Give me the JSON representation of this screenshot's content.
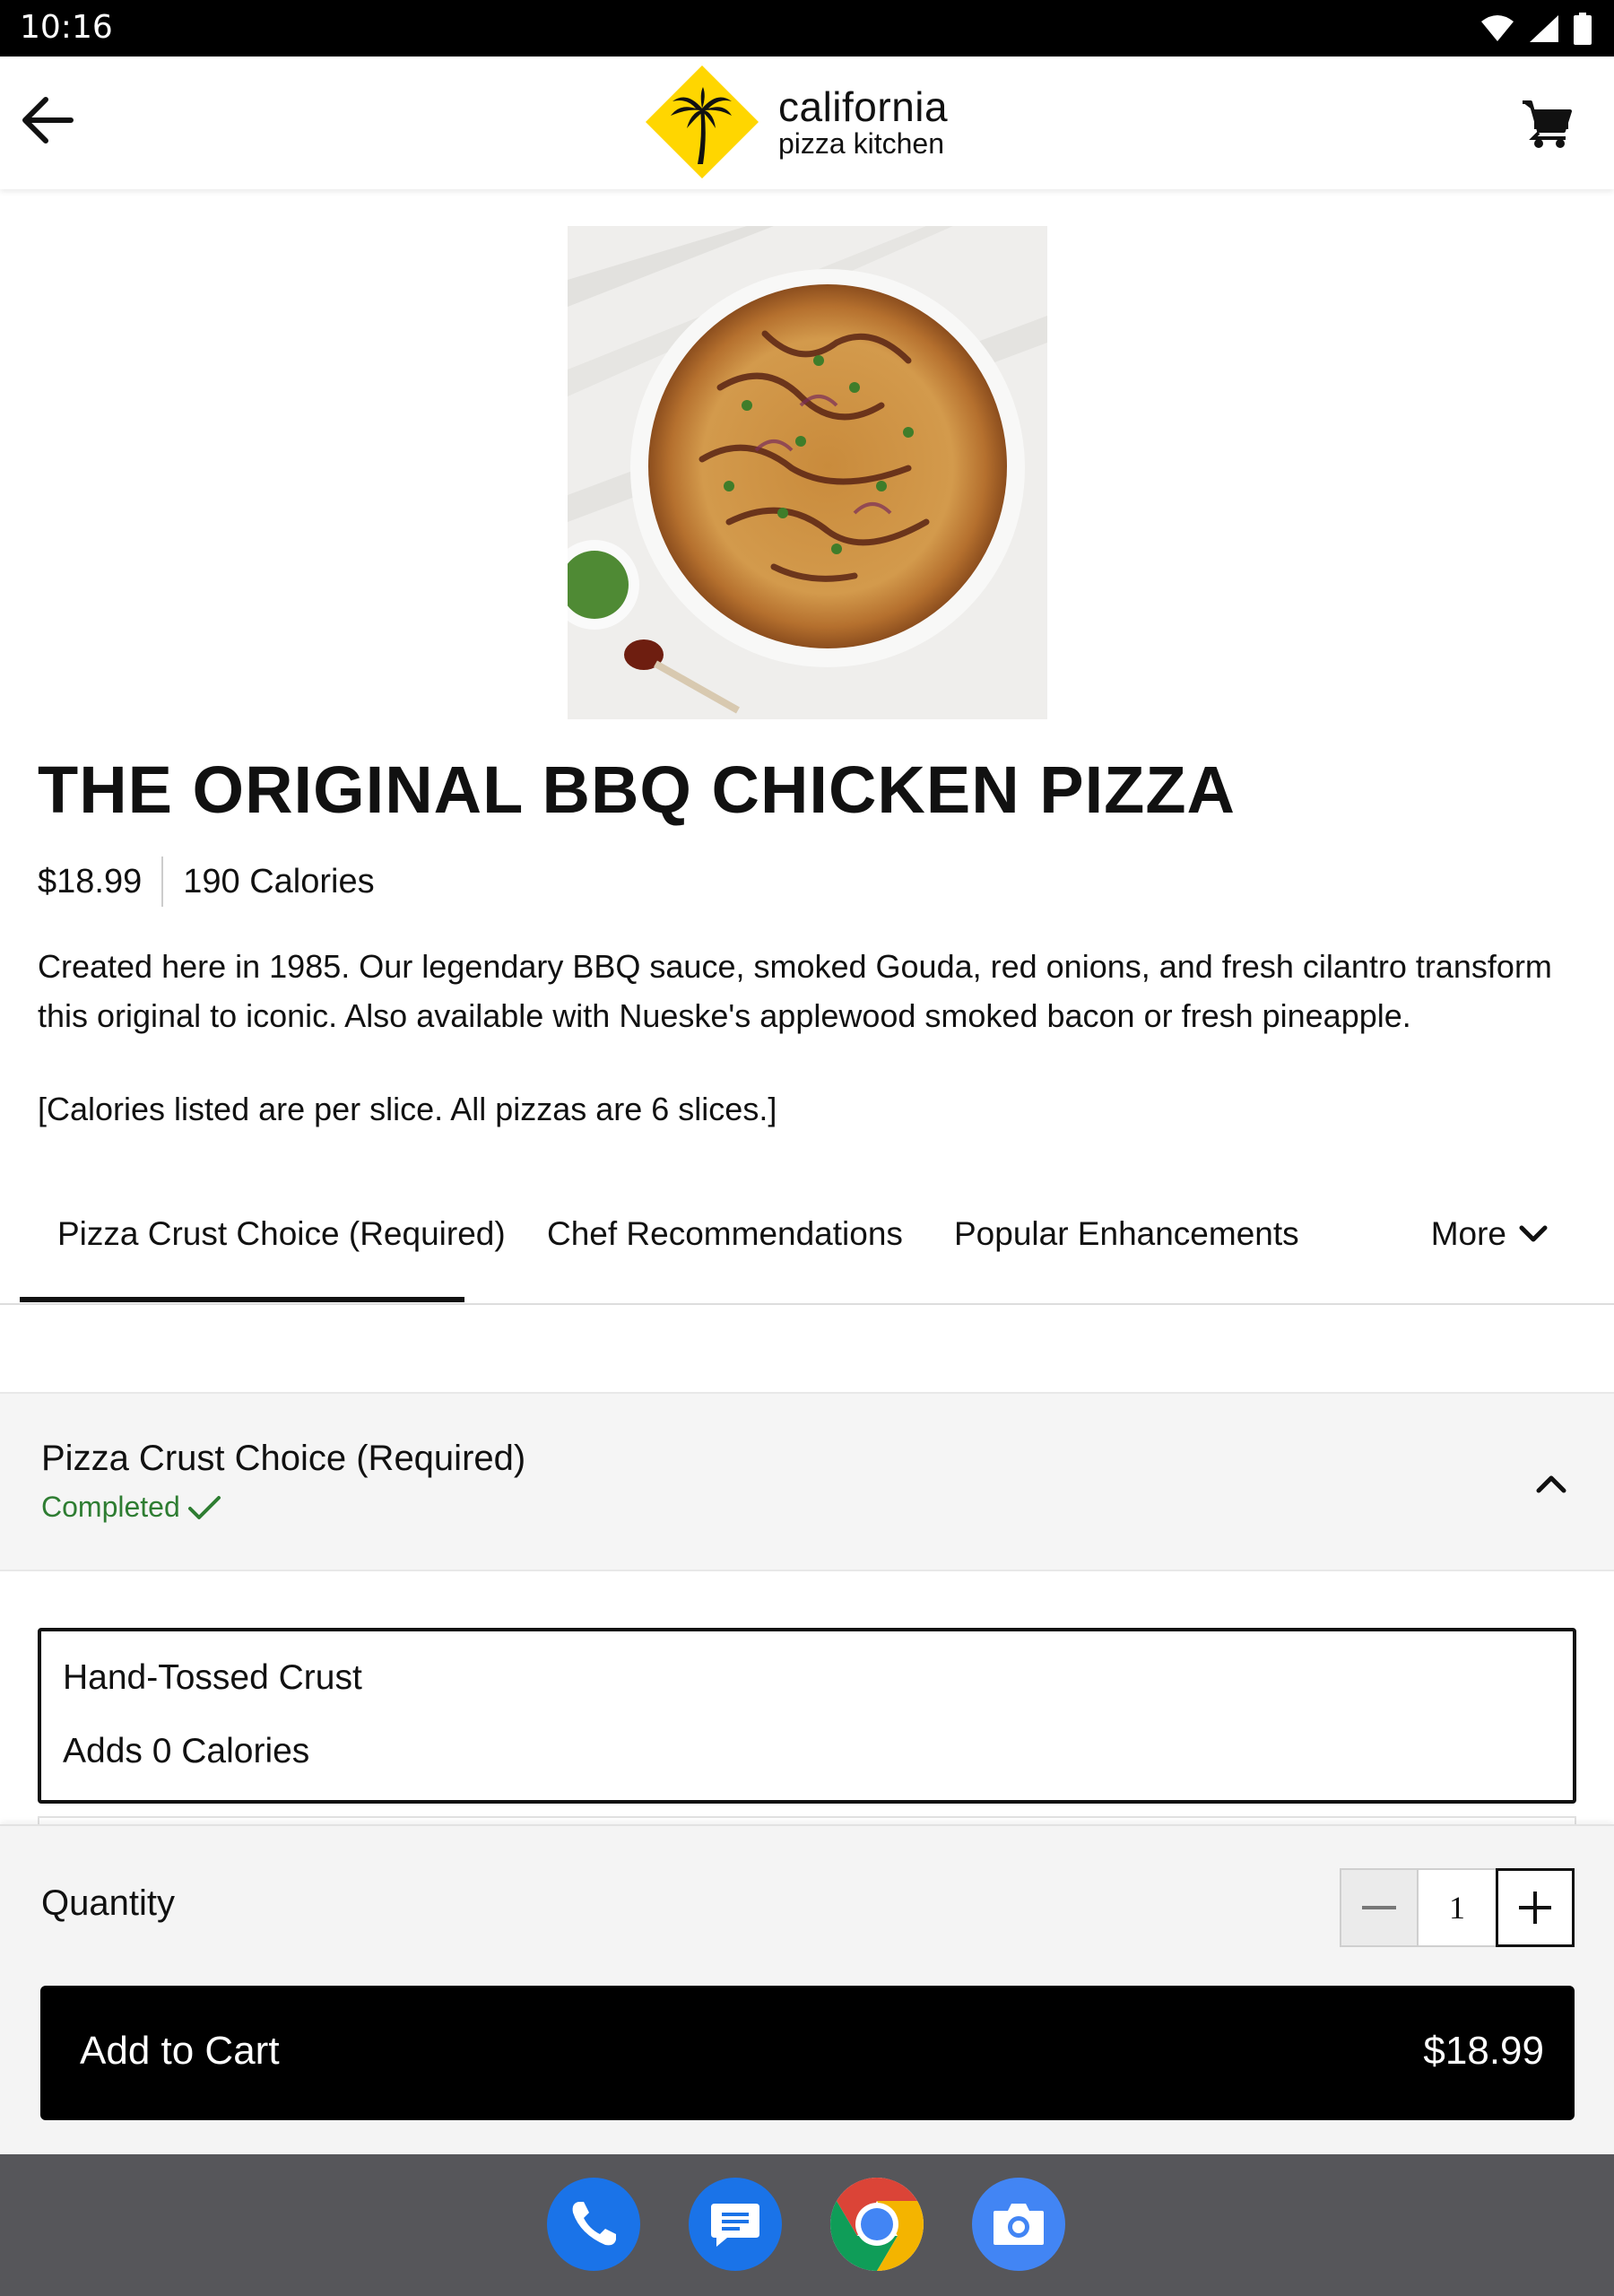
{
  "status_bar": {
    "time": "10:16"
  },
  "header": {
    "logo_line1": "california",
    "logo_line2": "pizza kitchen",
    "back_icon": "arrow-left-icon",
    "cart_icon": "shopping-cart-icon"
  },
  "product": {
    "image": "bbq-chicken-pizza-photo",
    "title": "THE ORIGINAL BBQ CHICKEN PIZZA",
    "price": "$18.99",
    "calories": "190 Calories",
    "description": "Created here in 1985. Our legendary BBQ sauce, smoked Gouda, red onions, and fresh cilantro transform this original to iconic. Also available with Nueske's applewood smoked bacon or fresh pineapple.",
    "calorie_note": "[Calories listed are per slice. All pizzas are 6 slices.]"
  },
  "tabs": {
    "items": [
      {
        "label": "Pizza Crust Choice (Required)",
        "active": true
      },
      {
        "label": "Chef Recommendations",
        "active": false
      },
      {
        "label": "Popular Enhancements",
        "active": false
      }
    ],
    "more_label": "More"
  },
  "section": {
    "title": "Pizza Crust Choice (Required)",
    "status": "Completed",
    "status_color": "#2e7d32"
  },
  "option": {
    "name": "Hand-Tossed Crust",
    "calories": "Adds 0 Calories",
    "selected": true
  },
  "quantity": {
    "label": "Quantity",
    "value": "1"
  },
  "add_to_cart": {
    "label": "Add to Cart",
    "price": "$18.99"
  },
  "dock": {
    "apps": [
      "phone-icon",
      "messages-icon",
      "chrome-icon",
      "camera-icon"
    ]
  },
  "colors": {
    "brand_yellow": "#FFD600",
    "button_black": "#000000",
    "success_green": "#2e7d32"
  }
}
